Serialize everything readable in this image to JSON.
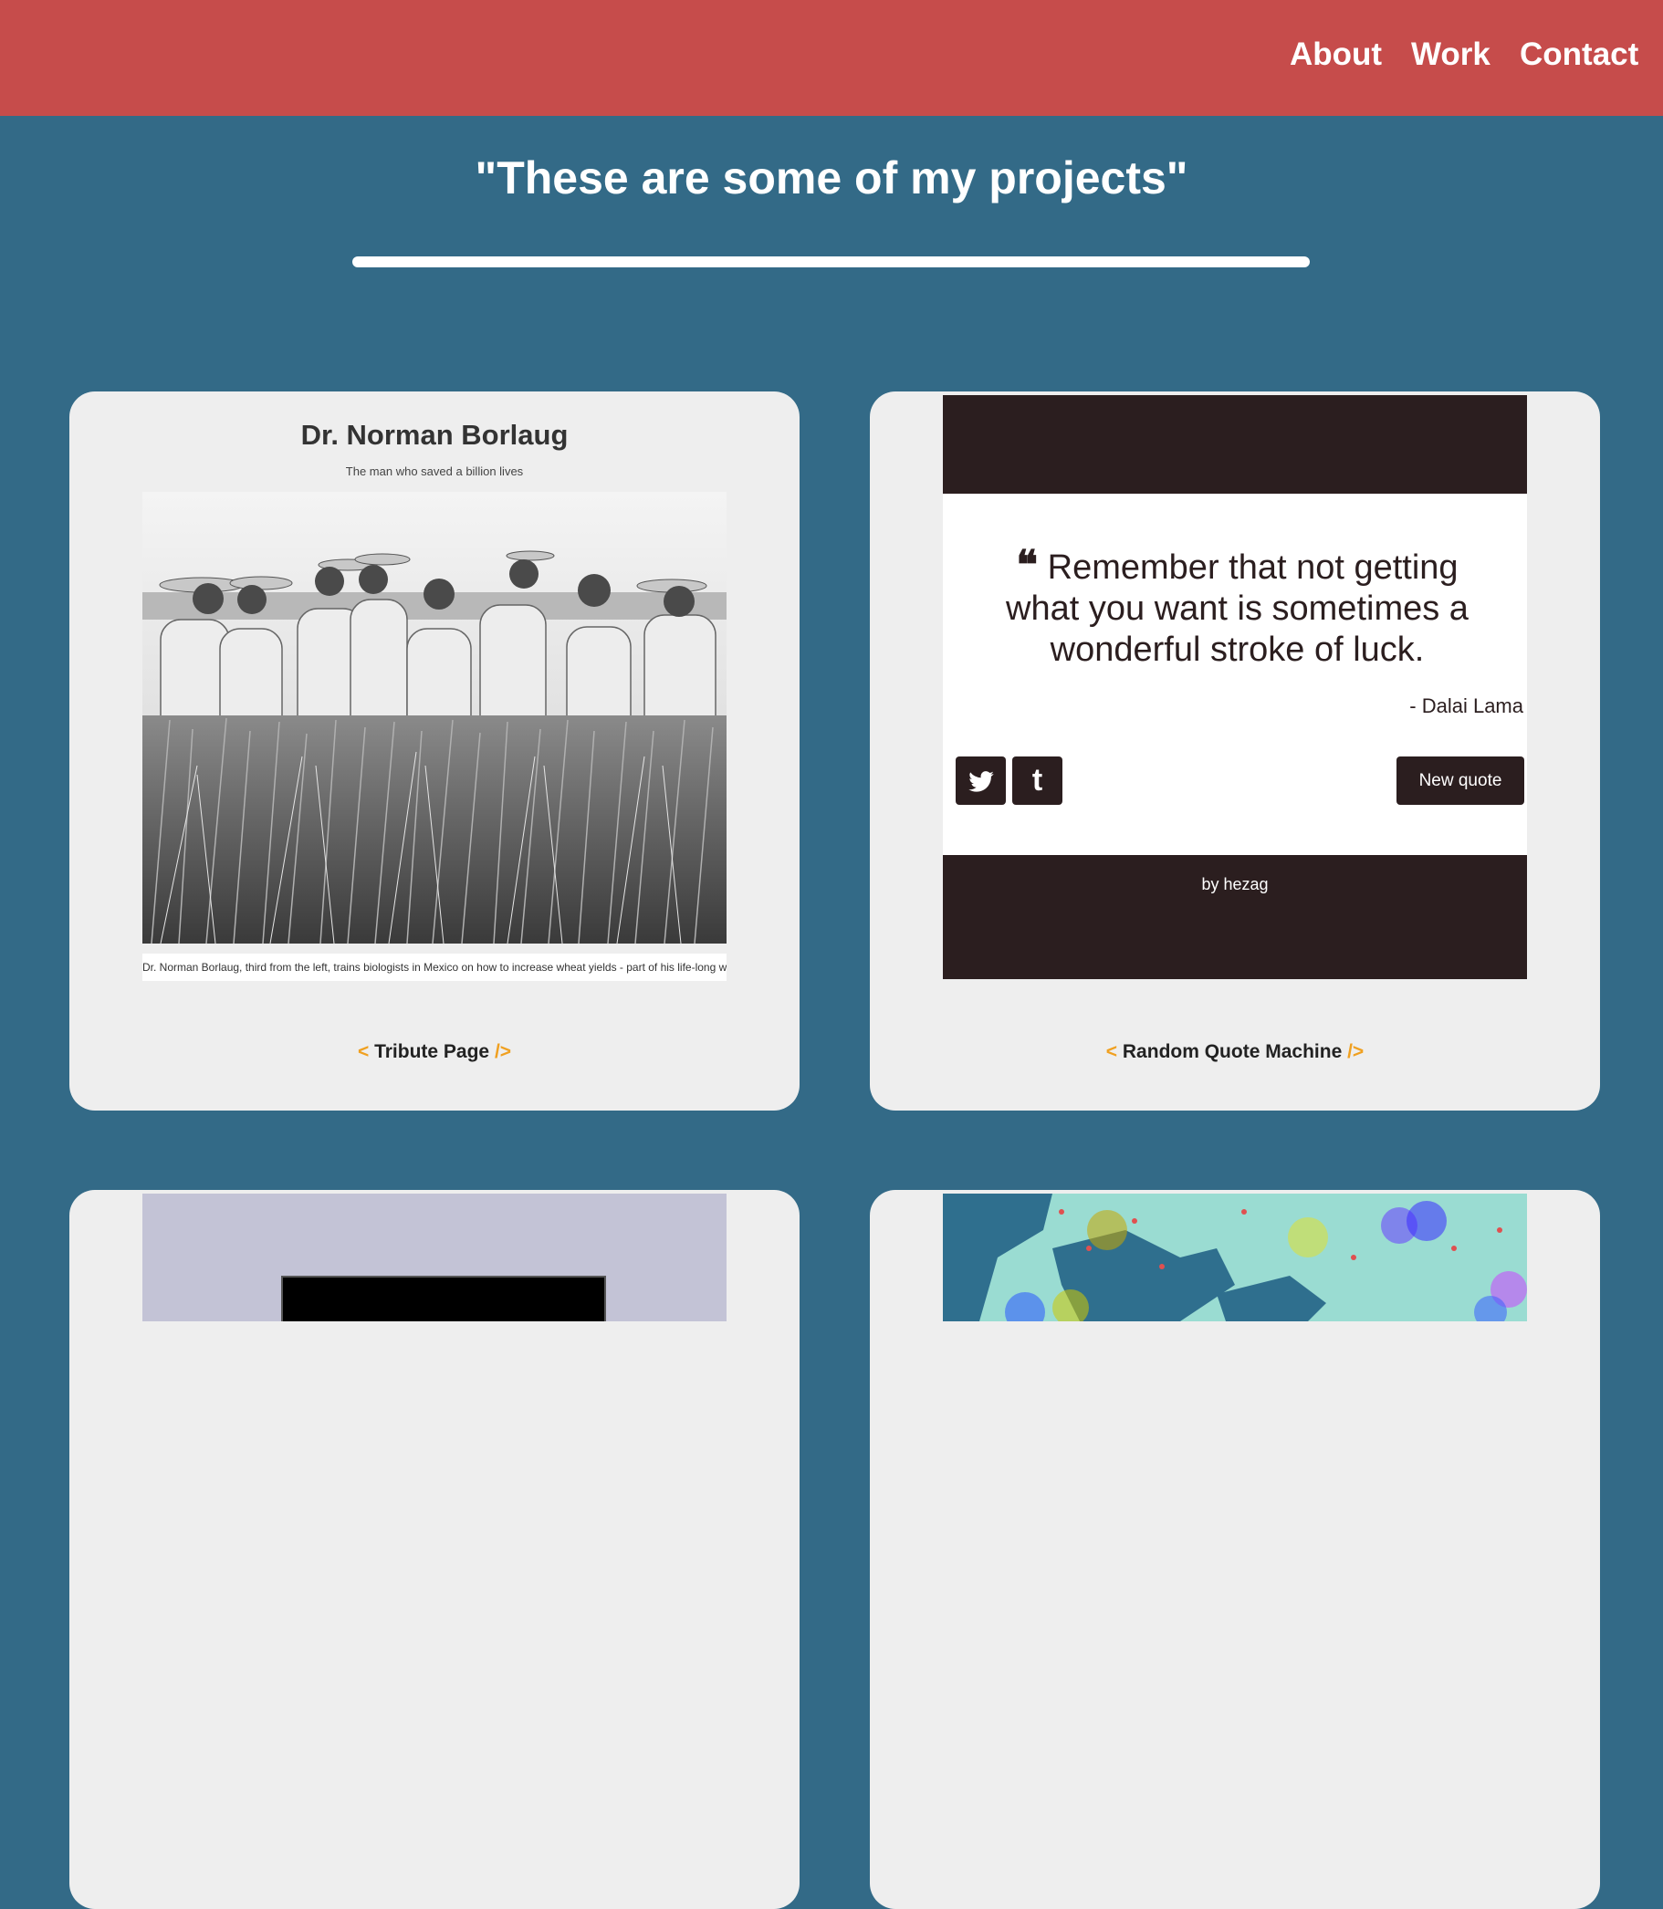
{
  "nav": {
    "items": [
      "About",
      "Work",
      "Contact"
    ]
  },
  "headline": "\"These are some of my projects\"",
  "projects": [
    {
      "caption": "Tribute Page",
      "screenshot": {
        "title": "Dr. Norman Borlaug",
        "subtitle": "The man who saved a billion lives",
        "photo_caption": "Dr. Norman Borlaug, third from the left, trains biologists in Mexico on how to increase wheat yields - part of his life-long war on hunger."
      }
    },
    {
      "caption": "Random Quote Machine",
      "screenshot": {
        "quote_mark": "❝",
        "quote": "Remember that not getting what you want is sometimes a wonderful stroke of luck.",
        "author": "- Dalai Lama",
        "twitter_glyph": "t",
        "tumblr_glyph": "t",
        "button": "New quote",
        "by_prefix": "by ",
        "by_name": "hezag"
      }
    }
  ],
  "bracket_open": "<",
  "bracket_close": "/>",
  "colors": {
    "nav": "#c64c4b",
    "page": "#336a87",
    "card": "#eeeeee",
    "accent": "#f0a020",
    "quote_dark": "#2b1e1f"
  }
}
